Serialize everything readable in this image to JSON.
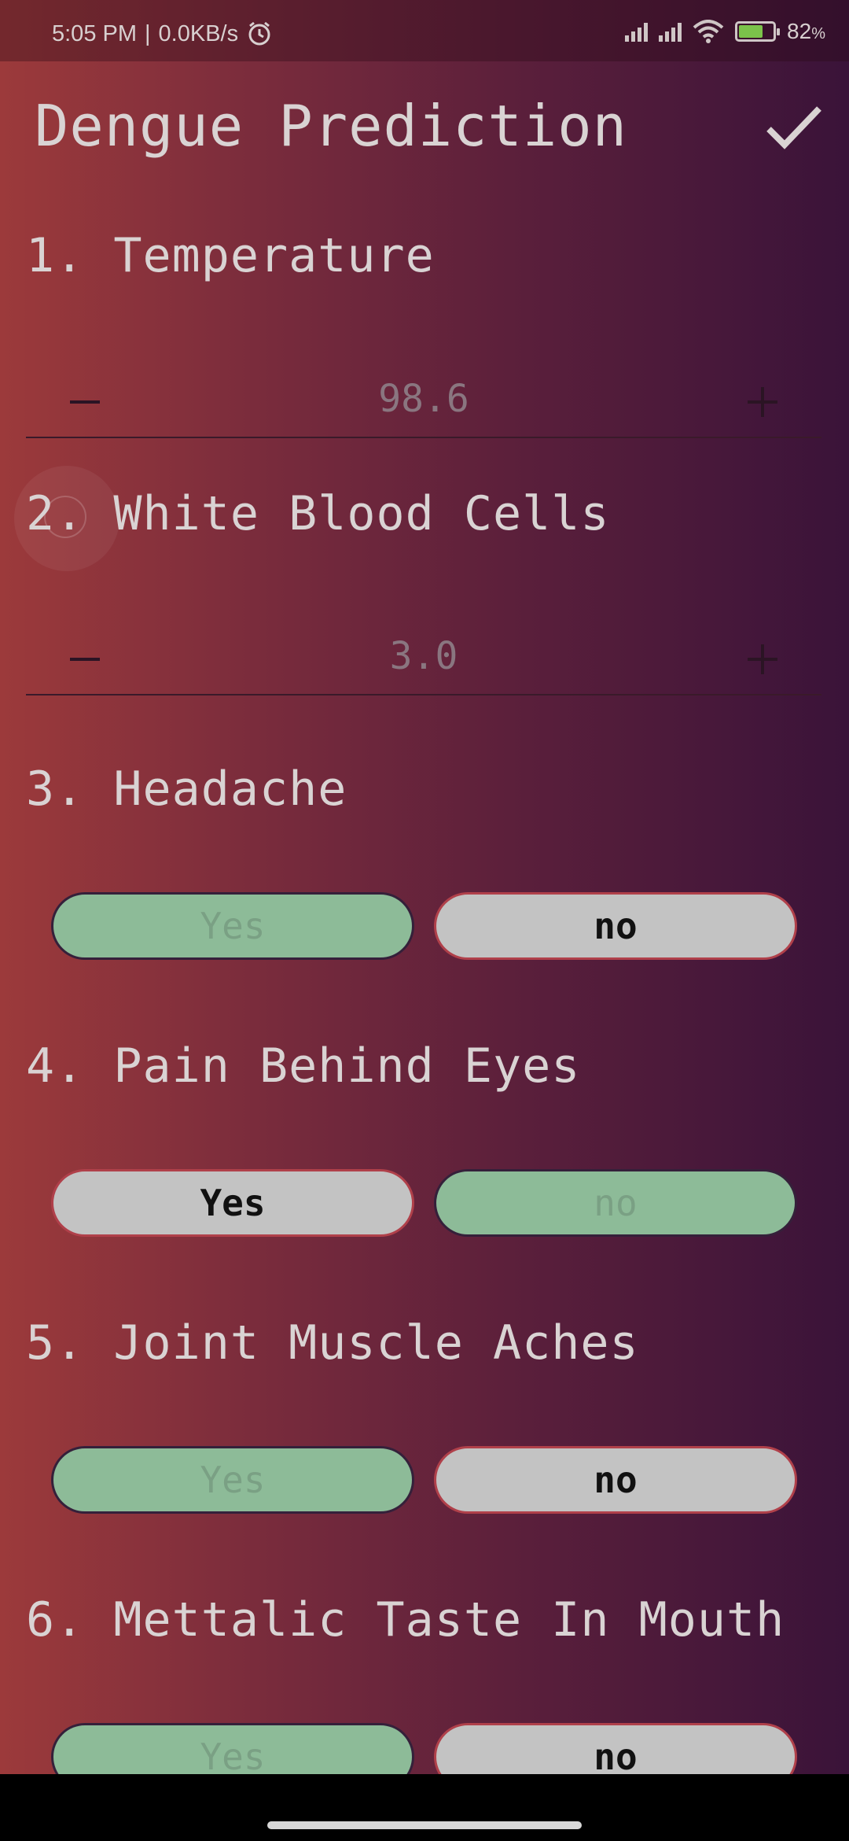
{
  "status_bar": {
    "time": "5:05 PM",
    "separator": "|",
    "speed": "0.0KB/s",
    "battery_percent": "82",
    "battery_unit": "%",
    "icons": [
      "alarm-icon",
      "signal-icon",
      "signal-icon",
      "wifi-icon",
      "battery-charging-icon"
    ]
  },
  "app_bar": {
    "title": "Dengue Prediction",
    "action_icon": "check-icon"
  },
  "questions": {
    "q1": {
      "label": "1. Temperature",
      "value": "98.6"
    },
    "q2": {
      "label": "2. White Blood Cells",
      "value": "3.0"
    },
    "q3": {
      "label": "3. Headache",
      "yes": "Yes",
      "no": "no",
      "selected": "Yes"
    },
    "q4": {
      "label": "4. Pain Behind Eyes",
      "yes": "Yes",
      "no": "no",
      "selected": "no"
    },
    "q5": {
      "label": "5. Joint Muscle Aches",
      "yes": "Yes",
      "no": "no",
      "selected": "Yes"
    },
    "q6": {
      "label": "6. Mettalic Taste In Mouth",
      "yes": "Yes",
      "no": "no",
      "selected": "Yes"
    }
  },
  "colors": {
    "gradient_start": "#9c3a3b",
    "gradient_end": "#3a1339",
    "selected_pill": "#8dbb98",
    "unselected_pill": "#c3c3c3"
  }
}
